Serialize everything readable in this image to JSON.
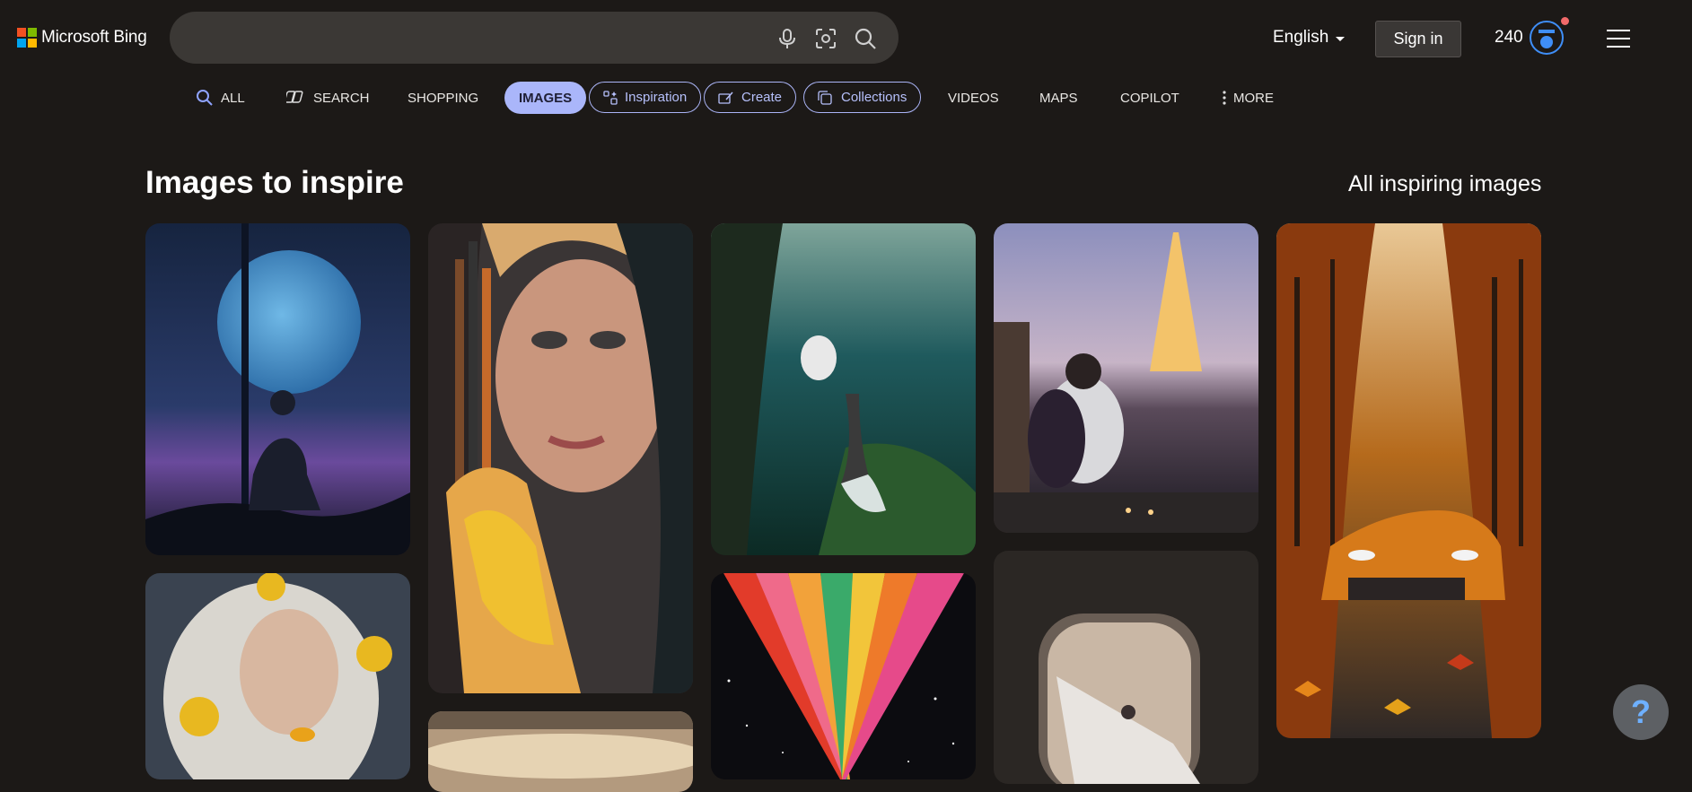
{
  "header": {
    "logo_text": "Microsoft Bing",
    "search": {
      "value": "",
      "placeholder": ""
    },
    "language": "English",
    "signin_label": "Sign in",
    "points": "240"
  },
  "nav": {
    "items": [
      {
        "label": "ALL"
      },
      {
        "label": "SEARCH"
      },
      {
        "label": "SHOPPING"
      },
      {
        "label": "IMAGES"
      },
      {
        "label": "Inspiration"
      },
      {
        "label": "Create"
      },
      {
        "label": "Collections"
      },
      {
        "label": "VIDEOS"
      },
      {
        "label": "MAPS"
      },
      {
        "label": "COPILOT"
      },
      {
        "label": "MORE"
      }
    ],
    "active": "IMAGES"
  },
  "section": {
    "title": "Images to inspire",
    "all_link": "All inspiring images"
  },
  "help_label": "?",
  "colors": {
    "background": "#1c1917",
    "accent": "#aab6fa",
    "searchbar": "#3b3835"
  }
}
